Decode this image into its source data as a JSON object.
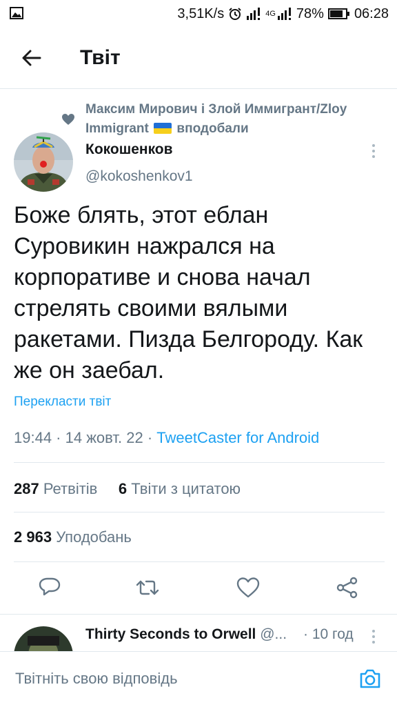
{
  "status_bar": {
    "network_speed": "3,51K/s",
    "network_type": "4G",
    "battery": "78%",
    "time": "06:28"
  },
  "header": {
    "title": "Твіт"
  },
  "liked_by": {
    "line1": "Максим Мирович і Злой Иммигрант/Zloy",
    "line2_name": "Immigrant",
    "line2_suffix": "вподобали"
  },
  "author": {
    "name": "Кокошенков",
    "handle": "@kokoshenkov1"
  },
  "tweet": {
    "text": "Боже блять, этот еблан Суровикин нажрался на корпоративе и снова начал стрелять своими вялыми ракетами. Пизда Белгороду. Как же он заебал.",
    "translate_label": "Перекласти твіт",
    "time": "19:44",
    "date": "14 жовт. 22",
    "source": "TweetCaster for Android"
  },
  "stats": {
    "retweets_count": "287",
    "retweets_label": "Ретвітів",
    "quotes_count": "6",
    "quotes_label": "Твіти з цитатою",
    "likes_count": "2 963",
    "likes_label": "Уподобань"
  },
  "reply_preview": {
    "name": "Thirty Seconds to Orwell",
    "handle": "@...",
    "time": "10 год"
  },
  "reply_bar": {
    "placeholder": "Твітніть свою відповідь"
  },
  "icons": {
    "back": "arrow-left-icon",
    "liked": "heart-filled-icon",
    "more": "more-vertical-icon",
    "reply": "reply-icon",
    "retweet": "retweet-icon",
    "like": "heart-outline-icon",
    "share": "share-icon",
    "camera": "camera-icon"
  },
  "colors": {
    "accent": "#1da1f2",
    "secondary_text": "#657786",
    "primary_text": "#14171a",
    "divider": "#e1e8ed"
  }
}
